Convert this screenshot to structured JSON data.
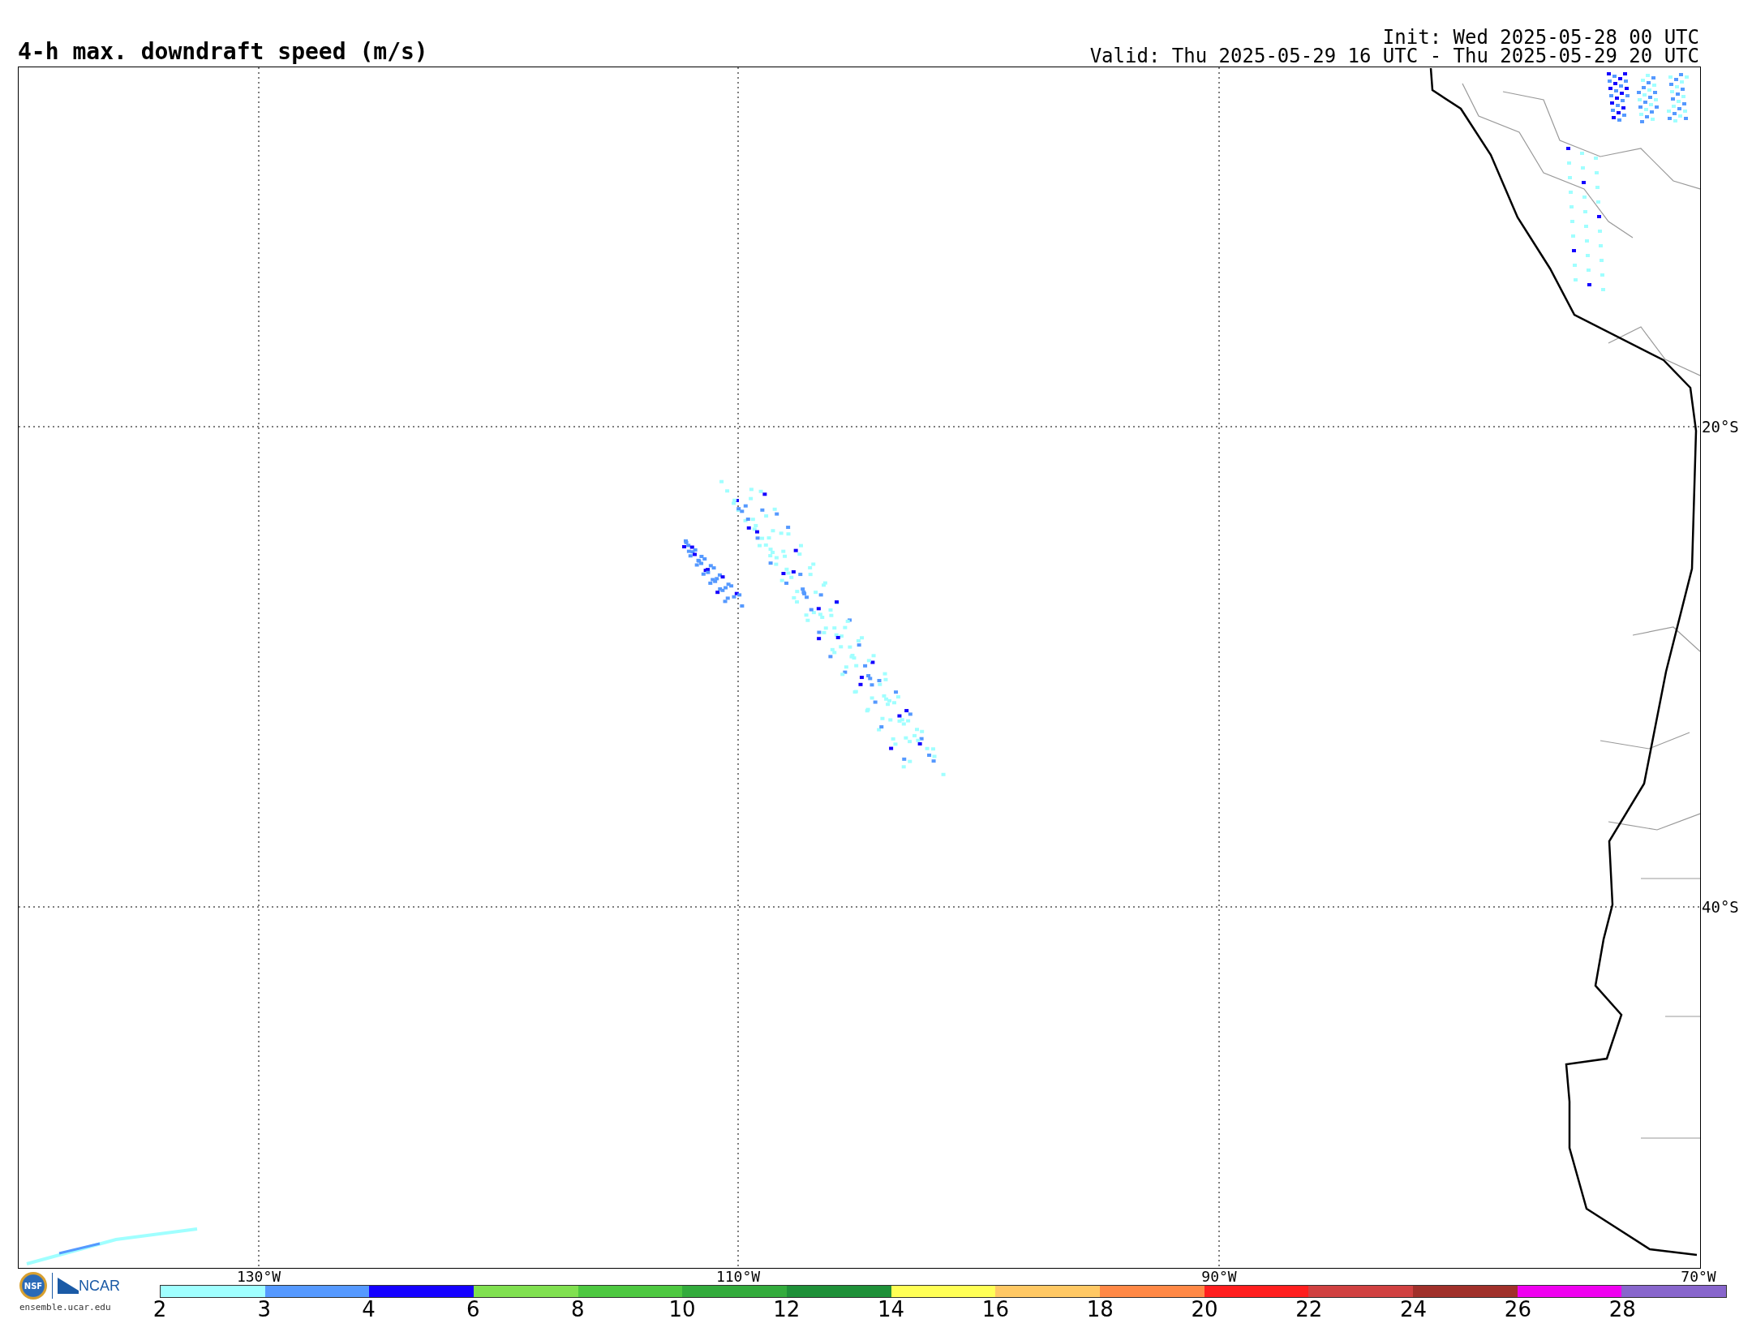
{
  "title": "4-h max. downdraft speed (m/s)",
  "init": "Init: Wed 2025-05-28 00 UTC",
  "valid": "Valid: Thu 2025-05-29 16 UTC - Thu 2025-05-29 20 UTC",
  "map": {
    "longitude_labels": [
      "130°W",
      "110°W",
      "90°W",
      "70°W"
    ],
    "latitude_labels": [
      "20°S",
      "40°S"
    ]
  },
  "colorbar": [
    {
      "label": "2",
      "color": "#a0ffff"
    },
    {
      "label": "3",
      "color": "#5599ff"
    },
    {
      "label": "4",
      "color": "#1400ff"
    },
    {
      "label": "6",
      "color": "#80e050"
    },
    {
      "label": "8",
      "color": "#4dc840"
    },
    {
      "label": "10",
      "color": "#32ab3c"
    },
    {
      "label": "12",
      "color": "#1e9038"
    },
    {
      "label": "14",
      "color": "#ffff55"
    },
    {
      "label": "16",
      "color": "#ffc864"
    },
    {
      "label": "18",
      "color": "#ff8845"
    },
    {
      "label": "20",
      "color": "#ff1e1e"
    },
    {
      "label": "22",
      "color": "#d04040"
    },
    {
      "label": "24",
      "color": "#a0302a"
    },
    {
      "label": "26",
      "color": "#f000f0"
    },
    {
      "label": "28",
      "color": "#8866cc"
    }
  ],
  "footer": {
    "seal_text": "NSF",
    "wordmark": "NCAR",
    "url": "ensemble.ucar.edu"
  }
}
